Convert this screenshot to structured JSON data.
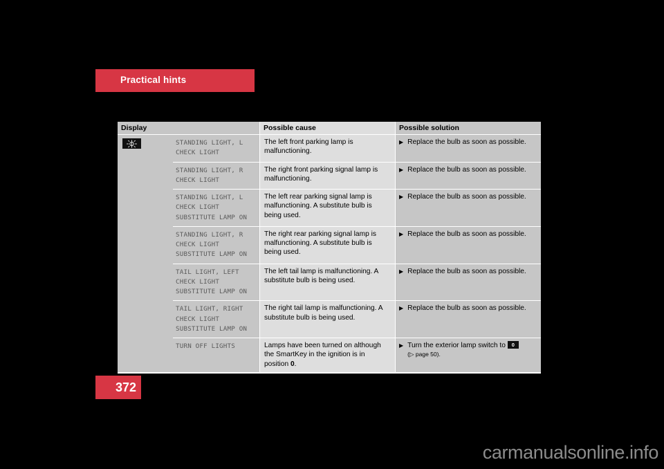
{
  "banner": {
    "title": "Practical hints"
  },
  "table": {
    "headers": {
      "display": "Display",
      "cause": "Possible cause",
      "solution": "Possible solution"
    },
    "icon": "standing-light-indicator-icon",
    "bullet_glyph": "▶",
    "rows": [
      {
        "display": "STANDING LIGHT, L\nCHECK LIGHT",
        "cause": "The left front parking lamp is malfunctioning.",
        "solution": "Replace the bulb as soon as possible."
      },
      {
        "display": "STANDING LIGHT, R\nCHECK LIGHT",
        "cause": "The right front parking signal lamp is malfunctioning.",
        "solution": "Replace the bulb as soon as possible."
      },
      {
        "display": "STANDING LIGHT, L\nCHECK LIGHT\nSUBSTITUTE LAMP ON",
        "cause": "The left rear parking signal lamp is malfunctioning. A substitute bulb is being used.",
        "solution": "Replace the bulb as soon as possible."
      },
      {
        "display": "STANDING LIGHT, R\nCHECK LIGHT\nSUBSTITUTE LAMP ON",
        "cause": "The right rear parking signal lamp is malfunctioning. A substitute bulb is being used.",
        "solution": "Replace the bulb as soon as possible."
      },
      {
        "display": "TAIL LIGHT, LEFT\nCHECK LIGHT\nSUBSTITUTE LAMP ON",
        "cause": "The left tail lamp is malfunctioning. A substitute bulb is being used.",
        "solution": "Replace the bulb as soon as possible."
      },
      {
        "display": "TAIL LIGHT, RIGHT\nCHECK LIGHT\nSUBSTITUTE LAMP ON",
        "cause": "The right tail lamp is malfunctioning. A substitute bulb is being used.",
        "solution": "Replace the bulb as soon as possible."
      },
      {
        "display": "TURN OFF LIGHTS",
        "cause_prefix": "Lamps have been turned on although the SmartKey in the ignition is in position ",
        "cause_bold": "0",
        "cause_suffix": ".",
        "solution_prefix": "Turn the exterior lamp switch to ",
        "solution_badge": "0",
        "solution_ref": "(▷ page 50)."
      }
    ]
  },
  "footer": {
    "page_number": "372"
  },
  "watermark": {
    "text": "carmanualsonline.info"
  }
}
